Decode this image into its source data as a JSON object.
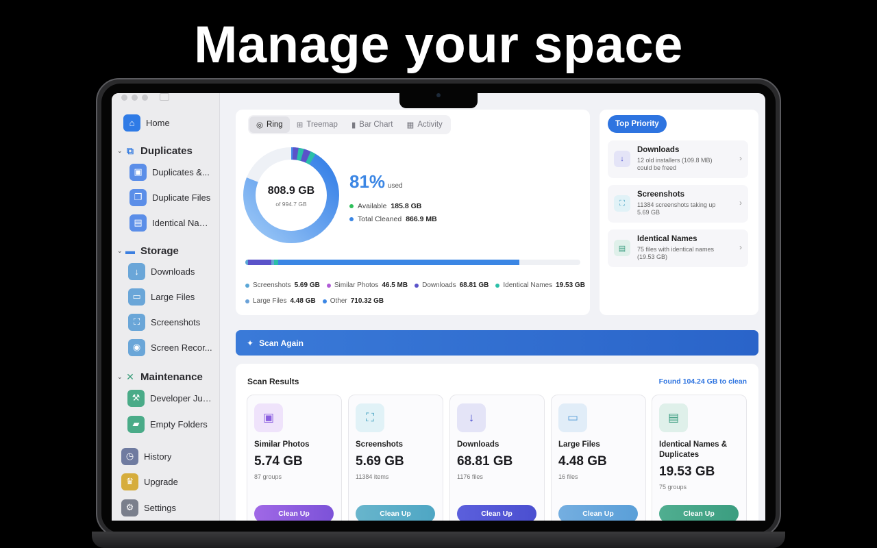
{
  "headline": "Manage your space",
  "sidebar": {
    "home": "Home",
    "duplicates_section": "Duplicates",
    "duplicates_items": [
      "Duplicates &...",
      "Duplicate Files",
      "Identical Nam..."
    ],
    "storage_section": "Storage",
    "storage_items": [
      "Downloads",
      "Large Files",
      "Screenshots",
      "Screen Recor..."
    ],
    "maintenance_section": "Maintenance",
    "maintenance_items": [
      "Developer Junk",
      "Empty Folders"
    ],
    "bottom_items": [
      "History",
      "Upgrade",
      "Settings"
    ]
  },
  "viz_tabs": [
    "Ring",
    "Treemap",
    "Bar Chart",
    "Activity"
  ],
  "ring": {
    "used_label": "808.9 GB",
    "total_label": "of 994.7 GB",
    "percent": "81%",
    "used_word": "used",
    "available_label": "Available",
    "available_value": "185.8 GB",
    "cleaned_label": "Total Cleaned",
    "cleaned_value": "866.9 MB",
    "used_fraction": 0.81
  },
  "legend": [
    {
      "name": "Screenshots",
      "value": "5.69 GB",
      "color": "#5aa6d6"
    },
    {
      "name": "Similar Photos",
      "value": "46.5 MB",
      "color": "#b05bd6"
    },
    {
      "name": "Downloads",
      "value": "68.81 GB",
      "color": "#5a53c9"
    },
    {
      "name": "Identical Names",
      "value": "19.53 GB",
      "color": "#2bbfa8"
    },
    {
      "name": "Large Files",
      "value": "4.48 GB",
      "color": "#6aa2d8"
    },
    {
      "name": "Other",
      "value": "710.32 GB",
      "color": "#3b86e4"
    }
  ],
  "priority": {
    "pill": "Top Priority",
    "items": [
      {
        "title": "Downloads",
        "desc": "12 old installers (109.8 MB) could be freed"
      },
      {
        "title": "Screenshots",
        "desc": "11384 screenshots taking up 5.69 GB"
      },
      {
        "title": "Identical Names",
        "desc": "75 files with identical names (19.53 GB)"
      }
    ]
  },
  "scan_again": "Scan Again",
  "results": {
    "title": "Scan Results",
    "found": "Found 104.24 GB to clean",
    "button": "Clean Up",
    "cards": [
      {
        "name": "Similar Photos",
        "size": "5.74 GB",
        "sub": "87 groups",
        "color": "#8b5fe0",
        "icon_bg": "#efe3fb"
      },
      {
        "name": "Screenshots",
        "size": "5.69 GB",
        "sub": "11384 items",
        "color": "#4ea6c4",
        "icon_bg": "#e1f2f7"
      },
      {
        "name": "Downloads",
        "size": "68.81 GB",
        "sub": "1176 files",
        "color": "#4b4fd0",
        "icon_bg": "#e4e4f7"
      },
      {
        "name": "Large Files",
        "size": "4.48 GB",
        "sub": "16 files",
        "color": "#5a9fd8",
        "icon_bg": "#e1edf8"
      },
      {
        "name": "Identical Names & Duplicates",
        "size": "19.53 GB",
        "sub": "75 groups",
        "color": "#3b9d80",
        "icon_bg": "#dff0ea"
      }
    ]
  }
}
